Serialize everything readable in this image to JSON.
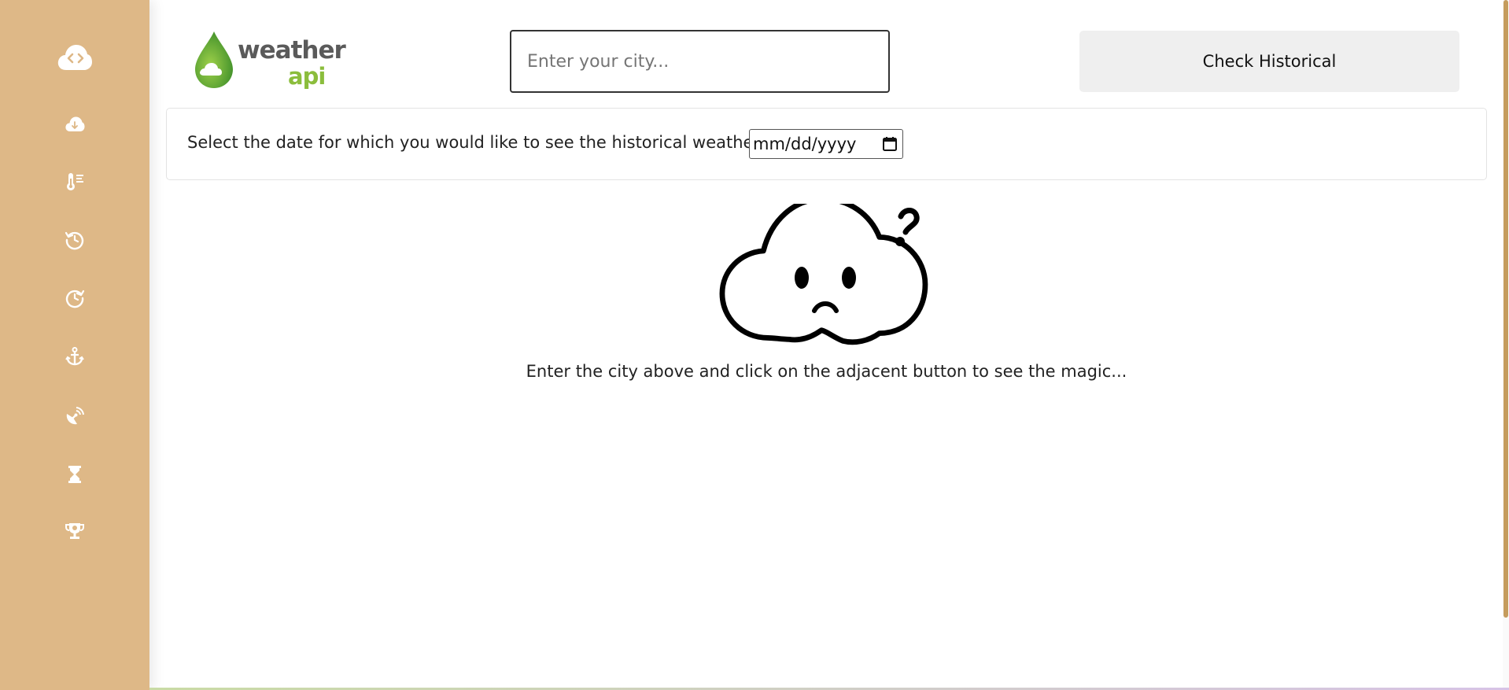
{
  "app": {
    "logo_word_1": "weather",
    "logo_word_2": "api"
  },
  "sidebar": {
    "items": [
      {
        "icon": "cloud-code-icon"
      },
      {
        "icon": "cloud-download-icon"
      },
      {
        "icon": "thermometer-icon"
      },
      {
        "icon": "history-icon"
      },
      {
        "icon": "clock-forward-icon"
      },
      {
        "icon": "anchor-icon"
      },
      {
        "icon": "satellite-icon"
      },
      {
        "icon": "hourglass-icon"
      },
      {
        "icon": "trophy-icon"
      }
    ]
  },
  "search": {
    "placeholder": "Enter your city...",
    "value": "",
    "button_label": "Check Historical"
  },
  "date_panel": {
    "label": "Select the date for which you would like to see the historical weather.",
    "date_placeholder": "mm/dd/yyyy"
  },
  "empty_state": {
    "illustration": "sad-cloud-icon",
    "message": "Enter the city above and click on the adjacent button to see the magic..."
  },
  "colors": {
    "sidebar": "#deb887",
    "button_bg": "#efefef",
    "logo_green": "#8bbd3c",
    "logo_gray": "#5a5a5a"
  }
}
